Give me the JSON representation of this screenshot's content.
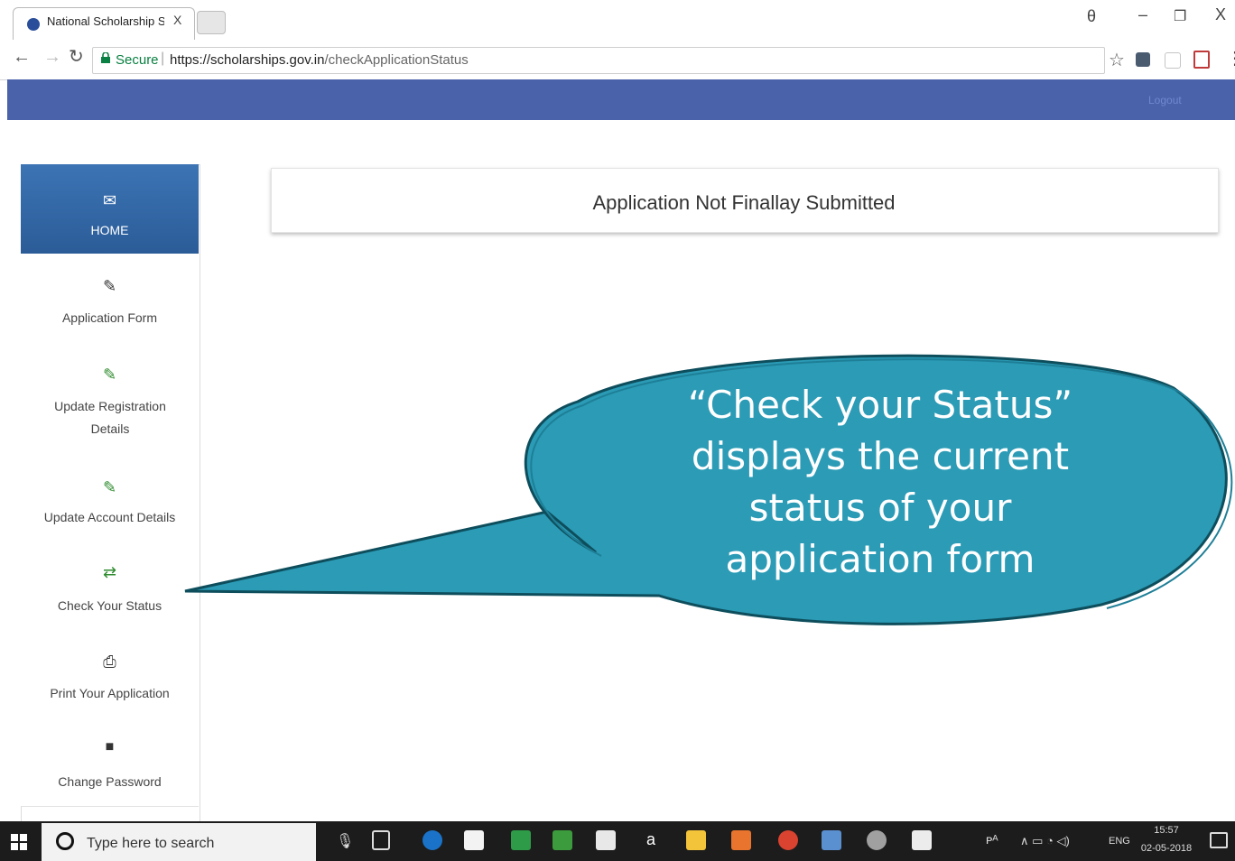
{
  "browser": {
    "tab_title": "National Scholarship Sch",
    "tab_close": "X",
    "secure_label": "Secure",
    "url_separator": "|",
    "url_host": "https://scholarships.gov.in",
    "url_path": "/checkApplicationStatus",
    "window_controls": {
      "user": "θ",
      "minimize": "–",
      "maximize": "❐",
      "close": "X"
    }
  },
  "header": {
    "logout_label": "Logout",
    "bar_color": "#4a62aa"
  },
  "sidebar": {
    "items": [
      {
        "label": "HOME",
        "icon": "envelope-icon",
        "glyph": "✉"
      },
      {
        "label": "Application Form",
        "icon": "edit-icon",
        "glyph": "✎"
      },
      {
        "label": "Update Registration Details",
        "icon": "edit-icon",
        "glyph": "✎"
      },
      {
        "label": "Update Account Details",
        "icon": "edit-icon",
        "glyph": "✎"
      },
      {
        "label": "Check Your Status",
        "icon": "exchange-icon",
        "glyph": "⇄"
      },
      {
        "label": "Print Your Application",
        "icon": "print-icon",
        "glyph": "⎙"
      },
      {
        "label": "Change Password",
        "icon": "lock-icon",
        "glyph": "■"
      }
    ],
    "active_color": "#2f64a3"
  },
  "main": {
    "status_message": "Application Not Finallay Submitted"
  },
  "callout": {
    "line1": "“Check your Status”",
    "line2": "displays the current",
    "line3": "status of your",
    "line4": "application form",
    "fill_color": "#2b9bb6"
  },
  "taskbar": {
    "search_placeholder": "Type here to search",
    "language": "ENG",
    "time": "15:57",
    "date": "02-05-2018"
  }
}
